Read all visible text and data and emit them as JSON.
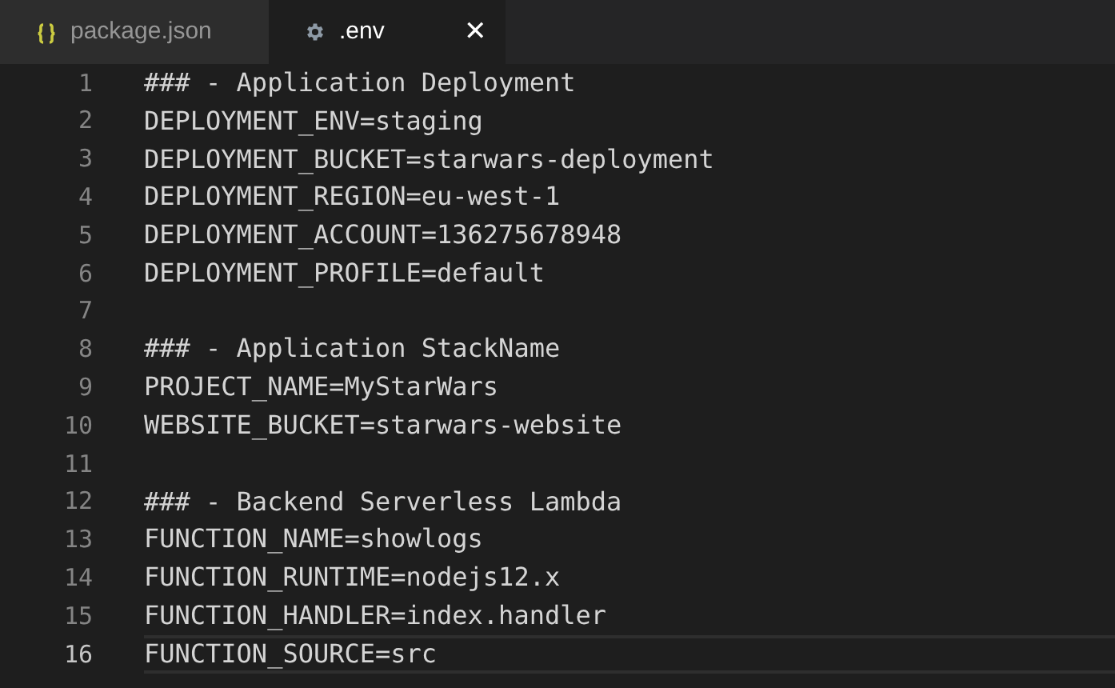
{
  "tabs": [
    {
      "label": "package.json",
      "kind": "json",
      "selected": false
    },
    {
      "label": ".env",
      "kind": "settings",
      "selected": true,
      "close": "✕"
    }
  ],
  "lines": [
    {
      "number": "1",
      "text": "### - Application Deployment",
      "current": false
    },
    {
      "number": "2",
      "text": "DEPLOYMENT_ENV=staging",
      "current": false
    },
    {
      "number": "3",
      "text": "DEPLOYMENT_BUCKET=starwars-deployment",
      "current": false
    },
    {
      "number": "4",
      "text": "DEPLOYMENT_REGION=eu-west-1",
      "current": false
    },
    {
      "number": "5",
      "text": "DEPLOYMENT_ACCOUNT=136275678948",
      "current": false
    },
    {
      "number": "6",
      "text": "DEPLOYMENT_PROFILE=default",
      "current": false
    },
    {
      "number": "7",
      "current": false
    },
    {
      "number": "8",
      "text": "### - Application StackName",
      "current": false
    },
    {
      "number": "9",
      "text": "PROJECT_NAME=MyStarWars",
      "current": false
    },
    {
      "number": "10",
      "text": "WEBSITE_BUCKET=starwars-website",
      "current": false
    },
    {
      "number": "11",
      "current": false
    },
    {
      "number": "12",
      "text": "### - Backend Serverless Lambda",
      "current": false
    },
    {
      "number": "13",
      "text": "FUNCTION_NAME=showlogs",
      "current": false
    },
    {
      "number": "14",
      "text": "FUNCTION_RUNTIME=nodejs12.x",
      "current": false
    },
    {
      "number": "15",
      "text": "FUNCTION_HANDLER=index.handler",
      "current": false
    },
    {
      "number": "16",
      "text": "FUNCTION_SOURCE=src",
      "current": true
    }
  ]
}
